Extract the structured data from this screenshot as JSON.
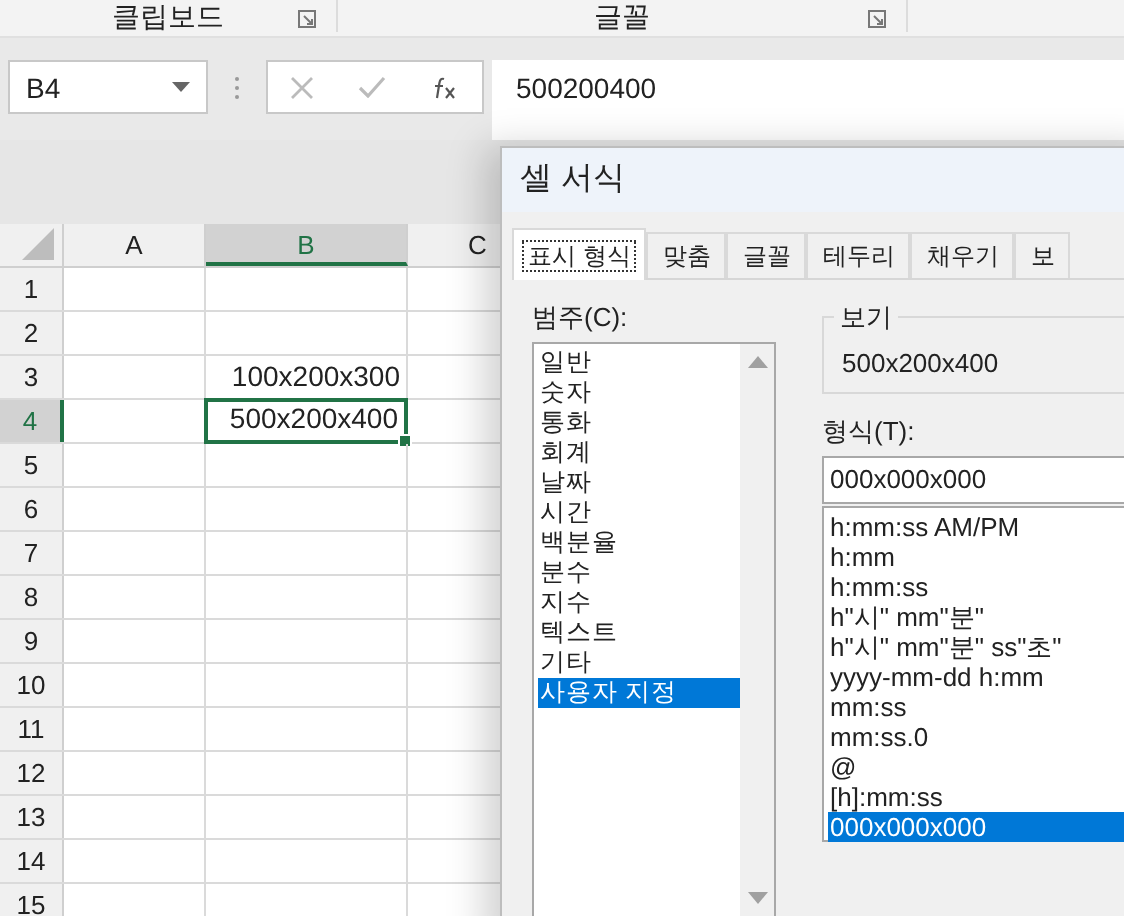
{
  "ribbon": {
    "groups": [
      {
        "label": "클립보드"
      },
      {
        "label": "글꼴"
      }
    ]
  },
  "formula_bar": {
    "name_box": "B4",
    "value": "500200400"
  },
  "sheet": {
    "columns": [
      {
        "label": "A",
        "selected": false
      },
      {
        "label": "B",
        "selected": true
      },
      {
        "label": "C",
        "selected": false
      }
    ],
    "rows": [
      {
        "label": "1",
        "selected": false
      },
      {
        "label": "2",
        "selected": false
      },
      {
        "label": "3",
        "selected": false,
        "column_b": {
          "text": "100x200x300",
          "selected": false
        }
      },
      {
        "label": "4",
        "selected": true,
        "column_b": {
          "text": "500x200x400",
          "selected": true
        }
      },
      {
        "label": "5",
        "selected": false
      },
      {
        "label": "6",
        "selected": false
      },
      {
        "label": "7",
        "selected": false
      },
      {
        "label": "8",
        "selected": false
      },
      {
        "label": "9",
        "selected": false
      },
      {
        "label": "10",
        "selected": false
      },
      {
        "label": "11",
        "selected": false
      },
      {
        "label": "12",
        "selected": false
      },
      {
        "label": "13",
        "selected": false
      },
      {
        "label": "14",
        "selected": false
      },
      {
        "label": "15",
        "selected": false
      }
    ]
  },
  "dialog": {
    "title": "셀 서식",
    "tabs": [
      {
        "label": "표시 형식",
        "selected": true
      },
      {
        "label": "맞춤",
        "selected": false
      },
      {
        "label": "글꼴",
        "selected": false
      },
      {
        "label": "테두리",
        "selected": false
      },
      {
        "label": "채우기",
        "selected": false
      },
      {
        "label": "보",
        "selected": false
      }
    ],
    "category_label": "범주(C):",
    "categories": [
      {
        "label": "일반",
        "selected": false
      },
      {
        "label": "숫자",
        "selected": false
      },
      {
        "label": "통화",
        "selected": false
      },
      {
        "label": "회계",
        "selected": false
      },
      {
        "label": "날짜",
        "selected": false
      },
      {
        "label": "시간",
        "selected": false
      },
      {
        "label": "백분율",
        "selected": false
      },
      {
        "label": "분수",
        "selected": false
      },
      {
        "label": "지수",
        "selected": false
      },
      {
        "label": "텍스트",
        "selected": false
      },
      {
        "label": "기타",
        "selected": false
      },
      {
        "label": "사용자 지정",
        "selected": true
      }
    ],
    "preview": {
      "label": "보기",
      "value": "500x200x400"
    },
    "format_label": "형식(T):",
    "format_value": "000x000x000",
    "formats": [
      {
        "label": "h:mm:ss AM/PM",
        "selected": false
      },
      {
        "label": "h:mm",
        "selected": false
      },
      {
        "label": "h:mm:ss",
        "selected": false
      },
      {
        "label": "h\"시\" mm\"분\"",
        "selected": false
      },
      {
        "label": "h\"시\" mm\"분\" ss\"초\"",
        "selected": false
      },
      {
        "label": "yyyy-mm-dd h:mm",
        "selected": false
      },
      {
        "label": "mm:ss",
        "selected": false
      },
      {
        "label": "mm:ss.0",
        "selected": false
      },
      {
        "label": "@",
        "selected": false
      },
      {
        "label": "[h]:mm:ss",
        "selected": false
      },
      {
        "label": "000x000x000",
        "selected": true
      }
    ]
  }
}
